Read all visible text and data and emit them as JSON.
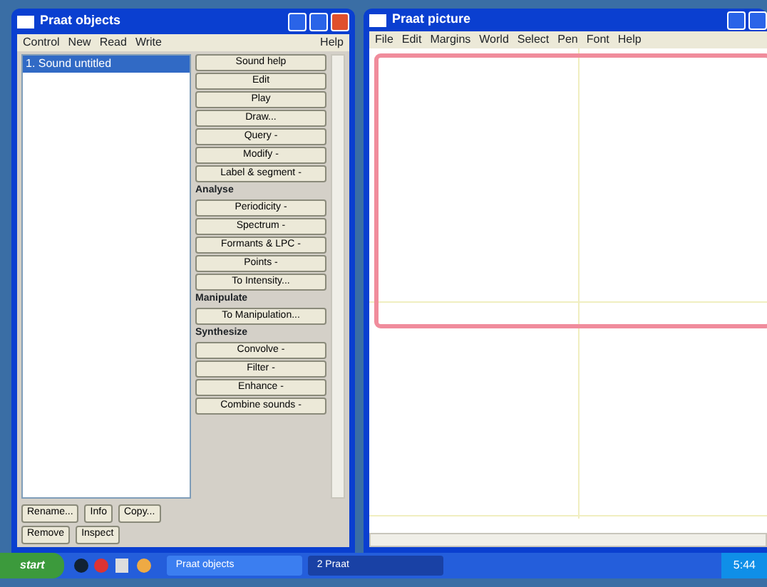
{
  "objects_window": {
    "title": "Praat objects",
    "menus": [
      {
        "label": "Control"
      },
      {
        "label": "New"
      },
      {
        "label": "Read"
      },
      {
        "label": "Write"
      },
      {
        "label": "Help"
      }
    ],
    "objects": [
      {
        "label": "1. Sound untitled",
        "selected": true
      }
    ],
    "command_groups": [
      {
        "buttons": [
          "Sound help",
          "Edit",
          "Play",
          "Draw...",
          "Query -",
          "Modify -",
          "Label & segment -"
        ]
      },
      {
        "header": "Analyse",
        "buttons": [
          "Periodicity -",
          "Spectrum -",
          "Formants & LPC -",
          "Points -",
          "To Intensity..."
        ]
      },
      {
        "header": "Manipulate",
        "buttons": [
          "To Manipulation..."
        ]
      },
      {
        "header": "Synthesize",
        "buttons": [
          "Convolve -",
          "Filter -",
          "Enhance -",
          "Combine sounds -"
        ]
      }
    ],
    "bottom_rows": [
      [
        "Rename...",
        "Info",
        "Copy..."
      ],
      [
        "Remove",
        "Inspect"
      ]
    ]
  },
  "picture_window": {
    "title": "Praat picture",
    "menus": [
      {
        "label": "File"
      },
      {
        "label": "Edit"
      },
      {
        "label": "Margins"
      },
      {
        "label": "World"
      },
      {
        "label": "Select"
      },
      {
        "label": "Pen"
      },
      {
        "label": "Font"
      },
      {
        "label": "Help"
      }
    ]
  },
  "taskbar": {
    "start": "start",
    "tasks": [
      {
        "label": "Praat objects",
        "active": false
      },
      {
        "label": "2 Praat",
        "active": true
      }
    ],
    "clock": "5:44"
  }
}
